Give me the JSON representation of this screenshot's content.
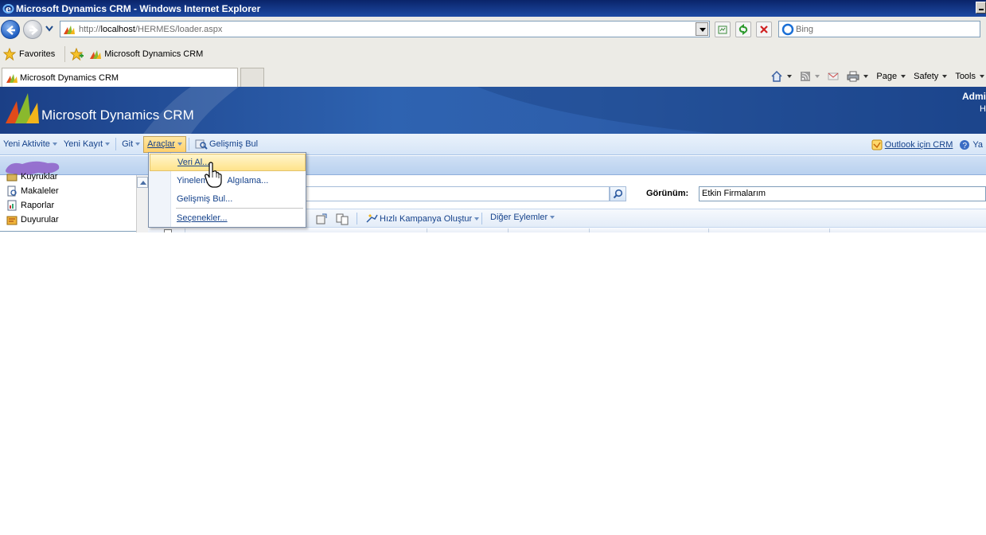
{
  "window": {
    "title": "Microsoft Dynamics CRM - Windows Internet Explorer"
  },
  "address_bar": {
    "url_prefix": "http://",
    "url_host": "localhost",
    "url_path": "/HERMES/loader.aspx",
    "search_placeholder": "Bing"
  },
  "favorites_bar": {
    "favorites_label": "Favorites",
    "items": [
      {
        "label": "Microsoft Dynamics CRM"
      }
    ]
  },
  "tabs": [
    {
      "label": "Microsoft Dynamics CRM",
      "active": true
    }
  ],
  "command_bar": {
    "page_label": "Page",
    "safety_label": "Safety",
    "tools_label": "Tools"
  },
  "crm_header": {
    "brand": "Microsoft Dynamics CRM",
    "user_partial": "Admi",
    "user_line2_partial": "H"
  },
  "crm_menu": {
    "items": [
      {
        "label": "Yeni Aktivite"
      },
      {
        "label": "Yeni Kayıt"
      },
      {
        "label": "Git"
      },
      {
        "label": "Araçlar"
      },
      {
        "label": "Gelişmiş Bul"
      }
    ],
    "right_items": [
      {
        "label": "Outlook için CRM"
      },
      {
        "label": "Ya"
      }
    ]
  },
  "tools_dropdown": {
    "items": [
      {
        "label": "Veri Al..."
      },
      {
        "label": "Yinelem",
        "label_suffix": "Algılama..."
      },
      {
        "label": "Gelişmiş Bul..."
      },
      {
        "label": "Seçenekler..."
      }
    ]
  },
  "left_nav": {
    "items": [
      {
        "label": "Kuyruklar",
        "icon": "folder-icon"
      },
      {
        "label": "Makaleler",
        "icon": "article-icon"
      },
      {
        "label": "Raporlar",
        "icon": "report-icon"
      },
      {
        "label": "Duyurular",
        "icon": "announcement-icon"
      }
    ]
  },
  "main": {
    "view_label": "Görünüm:",
    "view_value": "Etkin Firmalarım",
    "toolbar": {
      "quick_campaign": "Hızlı Kampanya Oluştur",
      "more_actions": "Diğer Eylemler"
    }
  },
  "colors": {
    "crm_header": "#2e63b1",
    "menu_text": "#15428b",
    "highlight": "#ffe38a"
  }
}
